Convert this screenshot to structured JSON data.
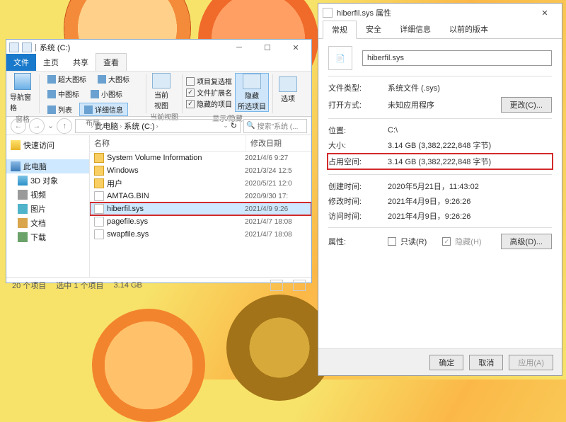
{
  "explorer": {
    "titlebar": {
      "path_hint": "系统 (C:)",
      "divider": "|"
    },
    "menu": {
      "file": "文件",
      "home": "主页",
      "share": "共享",
      "view": "查看"
    },
    "ribbon": {
      "nav_group_label": "窗格",
      "nav_pane": "导航窗格",
      "layout_group_label": "布局",
      "v_ultra_large": "超大图标",
      "v_large": "大图标",
      "v_medium": "中图标",
      "v_small": "小图标",
      "v_list": "列表",
      "v_details": "详细信息",
      "current_view_label": "当前视图",
      "current_view": "当前\n视图",
      "showhide_group_label": "显示/隐藏",
      "chk_item_check": "项目复选框",
      "chk_file_ext": "文件扩展名",
      "chk_hidden": "隐藏的项目",
      "hide_selected": "隐藏\n所选项目",
      "options": "选项"
    },
    "address": {
      "seg1": "此电脑",
      "seg2": "系统 (C:)",
      "search_placeholder": "搜索\"系统 (..."
    },
    "tree": {
      "quick": "快速访问",
      "this_pc": "此电脑",
      "t3d": "3D 对象",
      "tvid": "视频",
      "timg": "图片",
      "tdoc": "文档",
      "tdl": "下载"
    },
    "list": {
      "col_name": "名称",
      "col_date": "修改日期",
      "items": [
        {
          "name": "System Volume Information",
          "date": "2021/4/6 9:27",
          "type": "folder"
        },
        {
          "name": "Windows",
          "date": "2021/3/24 12:5",
          "type": "folder"
        },
        {
          "name": "用户",
          "date": "2020/5/21 12:0",
          "type": "folder"
        },
        {
          "name": "AMTAG.BIN",
          "date": "2020/9/30 17:",
          "type": "file"
        },
        {
          "name": "hiberfil.sys",
          "date": "2021/4/9 9:26",
          "type": "file",
          "sel": true,
          "hl": true
        },
        {
          "name": "pagefile.sys",
          "date": "2021/4/7 18:08",
          "type": "file"
        },
        {
          "name": "swapfile.sys",
          "date": "2021/4/7 18:08",
          "type": "file"
        }
      ]
    },
    "status": {
      "count": "20 个项目",
      "selected": "选中 1 个项目",
      "size": "3.14 GB"
    }
  },
  "props": {
    "title": "hiberfil.sys 属性",
    "tabs": {
      "general": "常规",
      "security": "安全",
      "details": "详细信息",
      "prev": "以前的版本"
    },
    "filename": "hiberfil.sys",
    "labels": {
      "filetype": "文件类型:",
      "opens_with": "打开方式:",
      "location": "位置:",
      "size": "大小:",
      "disk": "占用空间:",
      "created": "创建时间:",
      "modified": "修改时间:",
      "accessed": "访问时间:",
      "attrs": "属性:"
    },
    "values": {
      "filetype": "系统文件 (.sys)",
      "opens_with": "未知应用程序",
      "location": "C:\\",
      "size": "3.14 GB (3,382,222,848 字节)",
      "disk": "3.14 GB (3,382,222,848 字节)",
      "created": "2020年5月21日，11:43:02",
      "modified": "2021年4月9日，9:26:26",
      "accessed": "2021年4月9日，9:26:26"
    },
    "attrs": {
      "readonly": "只读(R)",
      "hidden": "隐藏(H)"
    },
    "buttons": {
      "change": "更改(C)...",
      "advanced": "高级(D)...",
      "ok": "确定",
      "cancel": "取消",
      "apply": "应用(A)"
    }
  }
}
